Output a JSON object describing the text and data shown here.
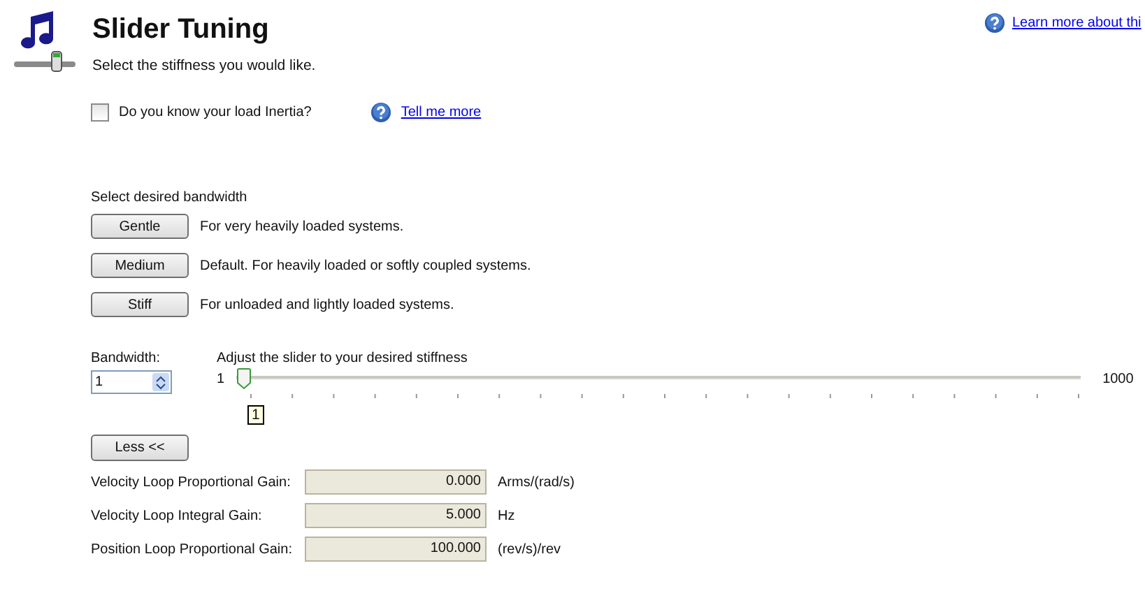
{
  "header": {
    "title": "Slider Tuning",
    "subtitle": "Select the stiffness you would like.",
    "help_link": "Learn more about thi"
  },
  "inertia": {
    "label": "Do you know your load Inertia?",
    "checked": false,
    "link": "Tell me more"
  },
  "bandwidth_section": {
    "heading": "Select desired bandwidth",
    "presets": [
      {
        "button": "Gentle",
        "description": "For very heavily loaded systems."
      },
      {
        "button": "Medium",
        "description": "Default. For heavily loaded or softly coupled systems."
      },
      {
        "button": "Stiff",
        "description": "For unloaded and lightly loaded systems."
      }
    ]
  },
  "bandwidth": {
    "label": "Bandwidth:",
    "value": "1"
  },
  "slider": {
    "caption": "Adjust the slider to your desired stiffness",
    "min_label": "1",
    "max_label": "1000",
    "value_label": "1",
    "level": 0
  },
  "less_button": "Less <<",
  "gains": [
    {
      "label": "Velocity Loop Proportional Gain:",
      "value": "0.000",
      "unit": "Arms/(rad/s)"
    },
    {
      "label": "Velocity Loop Integral Gain:",
      "value": "5.000",
      "unit": "Hz"
    },
    {
      "label": "Position Loop Proportional Gain:",
      "value": "100.000",
      "unit": "(rev/s)/rev"
    }
  ]
}
